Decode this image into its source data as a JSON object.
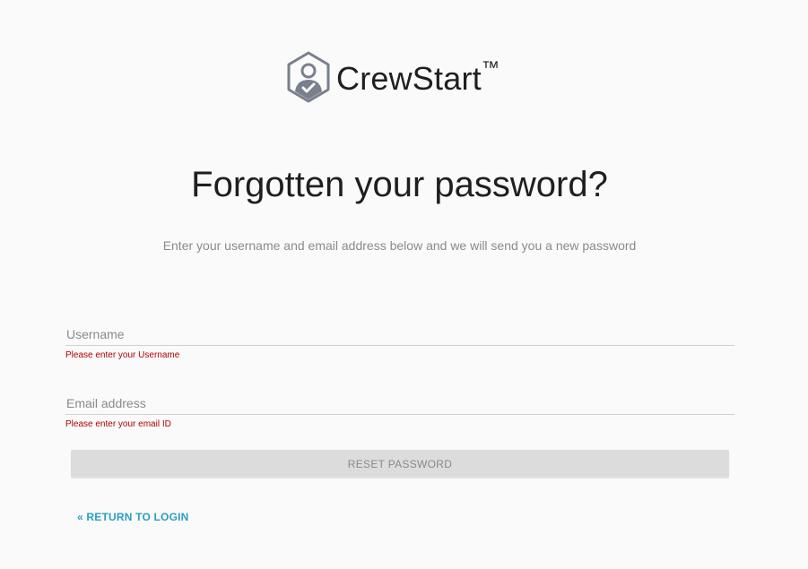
{
  "brand": {
    "name": "CrewStart",
    "trademark": "™",
    "logo_icon": "user-check-hexagon-icon"
  },
  "page": {
    "title": "Forgotten your password?",
    "subtitle": "Enter your username and email address below and we will send you a new password"
  },
  "form": {
    "username": {
      "placeholder": "Username",
      "value": "",
      "error": "Please enter your Username"
    },
    "email": {
      "placeholder": "Email address",
      "value": "",
      "error": "Please enter your email ID"
    },
    "reset_label": "RESET PASSWORD",
    "return_label": "« RETURN TO LOGIN"
  },
  "colors": {
    "background": "#fafafa",
    "error": "#b30000",
    "link": "#2a9ec4",
    "button_bg": "#dcdcdc",
    "logo": "#7a7f8c"
  }
}
